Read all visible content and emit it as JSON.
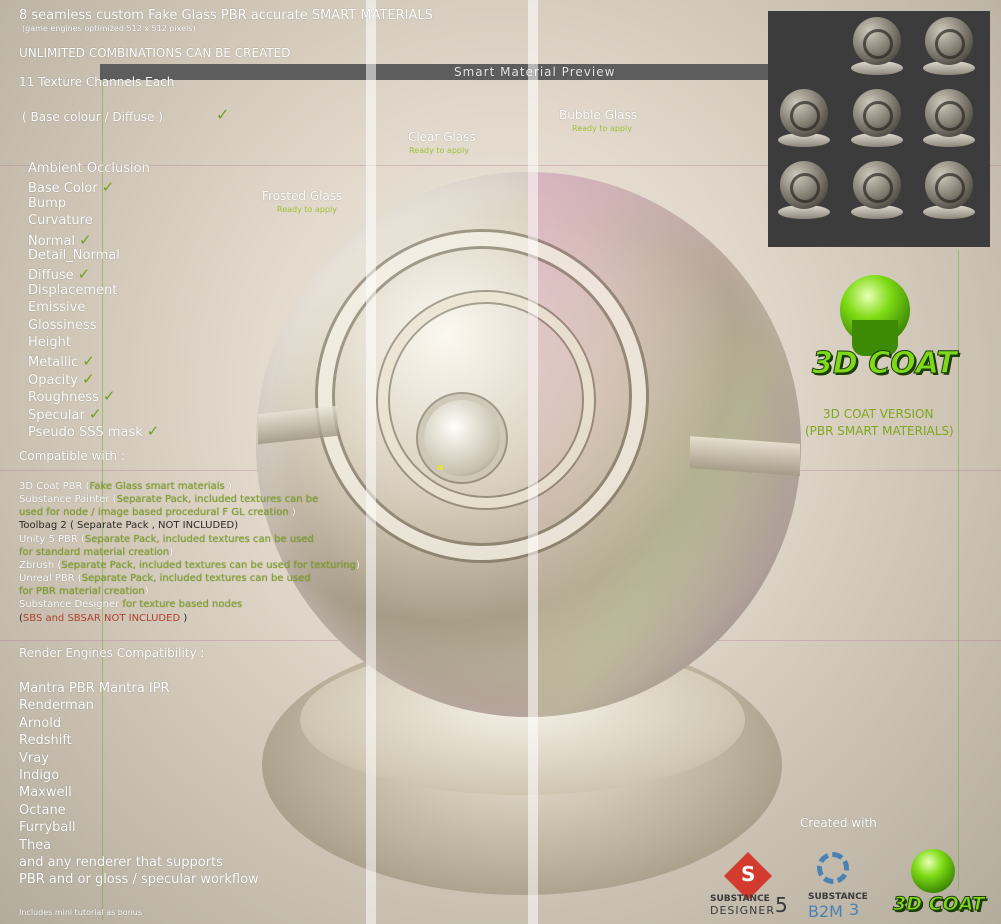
{
  "header": {
    "title": "8 seamless custom Fake Glass PBR accurate SMART MATERIALS",
    "subtitle": "(game engines optimized 512 x 512 pixels)",
    "unlimited": "UNLIMITED COMBINATIONS CAN BE CREATED",
    "channels_title": "11 Texture Channels Each",
    "base_colour": "( Base colour / Diffuse )"
  },
  "preview_bar": {
    "label": "Smart Material Preview"
  },
  "materials": [
    {
      "name": "Clear Glass",
      "status": "Ready to apply"
    },
    {
      "name": "Bubble Glass",
      "status": "Ready to apply"
    },
    {
      "name": "Frosted Glass",
      "status": "Ready to apply"
    }
  ],
  "channels": [
    {
      "label": "Ambient Occlusion",
      "check": false
    },
    {
      "label": "Base Color",
      "check": true
    },
    {
      "label": "Bump",
      "check": false
    },
    {
      "label": "Curvature",
      "check": false
    },
    {
      "label": "Normal",
      "check": true
    },
    {
      "label": "Detail_Normal",
      "check": false
    },
    {
      "label": "Diffuse",
      "check": true
    },
    {
      "label": "Displacement",
      "check": false
    },
    {
      "label": "Emissive",
      "check": false
    },
    {
      "label": "Glossiness",
      "check": false
    },
    {
      "label": "Height",
      "check": false
    },
    {
      "label": "Metallic",
      "check": true
    },
    {
      "label": "Opacity",
      "check": true
    },
    {
      "label": "Roughness",
      "check": true
    },
    {
      "label": "Specular",
      "check": true
    },
    {
      "label": "Pseudo SSS mask",
      "check": true
    }
  ],
  "check_glyph": "✓",
  "compatible": {
    "title": "Compatible with :",
    "items": [
      {
        "a": "3D Coat PBR (",
        "b": "Fake Glass smart materials",
        "c": " )"
      },
      {
        "a": "Substance Painter (",
        "b": "Separate Pack, included  textures can be",
        "c": ""
      },
      {
        "a": "",
        "b": "used for node / image based procedural F GL creation",
        "c": " )"
      },
      {
        "a": "Toolbag 2 ( Separate Pack , NOT INCLUDED)",
        "b": "",
        "c": ""
      },
      {
        "a": "Unity 5 PBR (",
        "b": "Separate Pack, included  textures can be used",
        "c": ""
      },
      {
        "a": "",
        "b": "for standard material creation",
        "c": ")"
      },
      {
        "a": "Zbrush (",
        "b": "Separate Pack, included  textures  can be used for texturing",
        "c": ")"
      },
      {
        "a": "Unreal PBR (",
        "b": "Separate Pack, included  textures can be used",
        "c": ""
      },
      {
        "a": "",
        "b": "for PBR material creation",
        "c": ")"
      },
      {
        "a": "Substance Designer",
        "b": " for texture based nodes",
        "c": ""
      },
      {
        "a": "(",
        "b": "SBS and SBSAR NOT INCLUDED",
        "c": " )"
      }
    ]
  },
  "render": {
    "title": "Render Engines Compatibility :",
    "items": [
      "Mantra PBR  Mantra IPR",
      "Renderman",
      "Arnold",
      "Redshift",
      "Vray",
      "Indigo",
      "Maxwell",
      "Octane",
      "Furryball",
      "Thea",
      "and any renderer that supports",
      "PBR and or gloss / specular workflow"
    ],
    "footnote": "Includes mini tutorial as bonus"
  },
  "coat": {
    "logo_text": "3D COAT",
    "version_line1": "3D COAT VERSION",
    "version_line2": "(PBR SMART MATERIALS)"
  },
  "created_with": "Created with",
  "logos": {
    "substance_designer_line1": "SUBSTANCE",
    "substance_designer_line2": "DESIGNER",
    "substance_designer_num": "5",
    "b2m_line1": "SUBSTANCE",
    "b2m_line2": "B2M",
    "b2m_num": "3",
    "coat_small": "3D COAT"
  },
  "colors": {
    "accent_green": "#7ea61e",
    "note_red": "#b0402e",
    "logo_green": "#7fd81a"
  }
}
